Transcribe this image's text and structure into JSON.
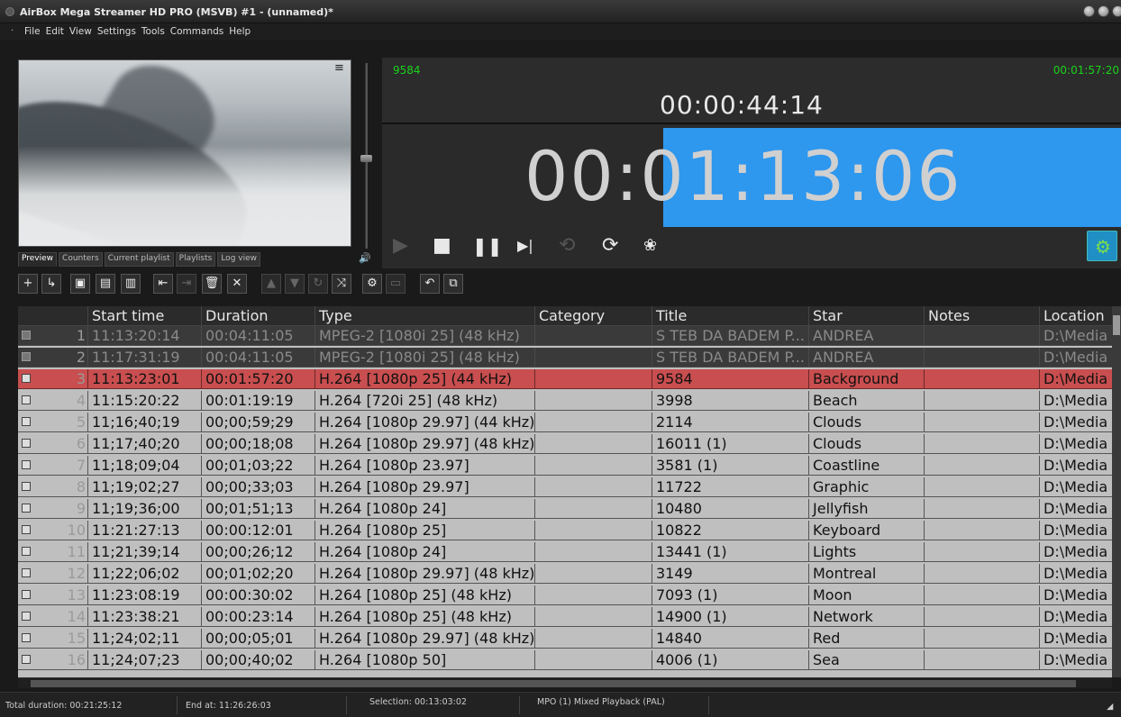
{
  "window": {
    "title": "AirBox Mega Streamer HD PRO (MSVB) #1 - (unnamed)*",
    "buttons": [
      "minimize",
      "maximize",
      "close"
    ]
  },
  "menu": {
    "dot": "·",
    "items": [
      "File",
      "Edit",
      "View",
      "Settings",
      "Tools",
      "Commands",
      "Help"
    ]
  },
  "preview": {
    "menu_icon": "≡",
    "tabs": [
      "Preview",
      "Counters",
      "Current playlist",
      "Playlists",
      "Log view"
    ],
    "active_tab": "Preview",
    "volume_icon": "speaker-icon"
  },
  "counters": {
    "clip_id": "9584",
    "clip_duration": "00:01:57:20",
    "elapsed": "00:00:44:14",
    "remaining": "00:01:13:06",
    "remaining_fraction": 0.62,
    "accent_color": "#2e97ee",
    "counter_green": "#19d419"
  },
  "playback_controls": {
    "play": "▶",
    "stop": "■",
    "pause": "❚❚",
    "next": "▶|",
    "undo": "⟲",
    "redo": "⟳",
    "film": "❀",
    "settings": "⚙"
  },
  "toolbar": {
    "icons": [
      "add-icon",
      "insert-icon",
      "save-icon",
      "save-as-icon",
      "export-icon",
      "move-left-icon",
      "move-right-icon",
      "delete-icon",
      "remove-icon",
      "move-up-icon",
      "move-down-icon",
      "loop-icon",
      "shuffle-icon",
      "settings-icon",
      "screen-icon",
      "undo-icon",
      "window-icon"
    ]
  },
  "table": {
    "columns": [
      "",
      "Start time",
      "Duration",
      "Type",
      "Category",
      "Title",
      "Star",
      "Notes",
      "Location"
    ],
    "rows": [
      {
        "n": "1",
        "start": "11:13:20:14",
        "dur": "00:04:11:05",
        "type": "MPEG-2 [1080i 25] (48 kHz)",
        "cat": "",
        "title": "S TEB DA BADEM P...",
        "star": "ANDREA",
        "notes": "",
        "loc": "D:\\Media",
        "state": "played"
      },
      {
        "n": "2",
        "start": "11:17:31:19",
        "dur": "00:04:11:05",
        "type": "MPEG-2 [1080i 25] (48 kHz)",
        "cat": "",
        "title": "S TEB DA BADEM P...",
        "star": "ANDREA",
        "notes": "",
        "loc": "D:\\Media",
        "state": "played"
      },
      {
        "n": "3",
        "start": "11:13:23:01",
        "dur": "00:01:57:20",
        "type": "H.264 [1080p 25] (44 kHz)",
        "cat": "",
        "title": "9584",
        "star": "Background",
        "notes": "",
        "loc": "D:\\Media",
        "state": "current"
      },
      {
        "n": "4",
        "start": "11:15:20:22",
        "dur": "00:01:19:19",
        "type": "H.264 [720i 25] (48 kHz)",
        "cat": "",
        "title": "3998",
        "star": "Beach",
        "notes": "",
        "loc": "D:\\Media",
        "state": "queued"
      },
      {
        "n": "5",
        "start": "11;16;40;19",
        "dur": "00;00;59;29",
        "type": "H.264 [1080p 29.97] (44 kHz)",
        "cat": "",
        "title": "2114",
        "star": "Clouds",
        "notes": "",
        "loc": "D:\\Media",
        "state": "queued"
      },
      {
        "n": "6",
        "start": "11;17;40;20",
        "dur": "00;00;18;08",
        "type": "H.264 [1080p 29.97] (48 kHz)",
        "cat": "",
        "title": "16011 (1)",
        "star": "Clouds",
        "notes": "",
        "loc": "D:\\Media",
        "state": "queued"
      },
      {
        "n": "7",
        "start": "11;18;09;04",
        "dur": "00;01;03;22",
        "type": "H.264 [1080p 23.97]",
        "cat": "",
        "title": "3581 (1)",
        "star": "Coastline",
        "notes": "",
        "loc": "D:\\Media",
        "state": "queued"
      },
      {
        "n": "8",
        "start": "11;19;02;27",
        "dur": "00;00;33;03",
        "type": "H.264 [1080p 29.97]",
        "cat": "",
        "title": "11722",
        "star": "Graphic",
        "notes": "",
        "loc": "D:\\Media",
        "state": "queued"
      },
      {
        "n": "9",
        "start": "11;19;36;00",
        "dur": "00;01;51;13",
        "type": "H.264 [1080p 24]",
        "cat": "",
        "title": "10480",
        "star": "Jellyfish",
        "notes": "",
        "loc": "D:\\Media",
        "state": "queued"
      },
      {
        "n": "10",
        "start": "11:21:27:13",
        "dur": "00:00:12:01",
        "type": "H.264 [1080p 25]",
        "cat": "",
        "title": "10822",
        "star": "Keyboard",
        "notes": "",
        "loc": "D:\\Media",
        "state": "queued"
      },
      {
        "n": "11",
        "start": "11;21;39;14",
        "dur": "00;00;26;12",
        "type": "H.264 [1080p 24]",
        "cat": "",
        "title": "13441 (1)",
        "star": "Lights",
        "notes": "",
        "loc": "D:\\Media",
        "state": "queued"
      },
      {
        "n": "12",
        "start": "11;22;06;02",
        "dur": "00;01;02;20",
        "type": "H.264 [1080p 29.97] (48 kHz)",
        "cat": "",
        "title": "3149",
        "star": "Montreal",
        "notes": "",
        "loc": "D:\\Media",
        "state": "queued"
      },
      {
        "n": "13",
        "start": "11:23:08:19",
        "dur": "00:00:30:02",
        "type": "H.264 [1080p 25] (48 kHz)",
        "cat": "",
        "title": "7093 (1)",
        "star": "Moon",
        "notes": "",
        "loc": "D:\\Media",
        "state": "queued"
      },
      {
        "n": "14",
        "start": "11:23:38:21",
        "dur": "00:00:23:14",
        "type": "H.264 [1080p 25] (48 kHz)",
        "cat": "",
        "title": "14900 (1)",
        "star": "Network",
        "notes": "",
        "loc": "D:\\Media",
        "state": "queued"
      },
      {
        "n": "15",
        "start": "11;24;02;11",
        "dur": "00;00;05;01",
        "type": "H.264 [1080p 29.97] (48 kHz)",
        "cat": "",
        "title": "14840",
        "star": "Red",
        "notes": "",
        "loc": "D:\\Media",
        "state": "queued"
      },
      {
        "n": "16",
        "start": "11;24;07;23",
        "dur": "00;00;40;02",
        "type": "H.264 [1080p 50]",
        "cat": "",
        "title": "4006 (1)",
        "star": "Sea",
        "notes": "",
        "loc": "D:\\Media",
        "state": "queued"
      }
    ]
  },
  "status": {
    "total": "Total duration: 00:21:25:12",
    "end": "End at: 11:26:26:03",
    "selection": "Selection: 00:13:03:02",
    "mode": "MPO (1) Mixed Playback (PAL)"
  }
}
